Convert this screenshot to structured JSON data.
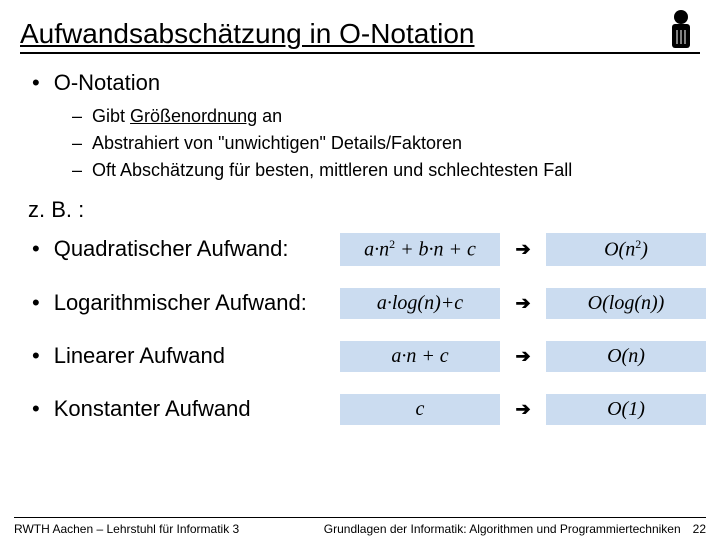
{
  "title": "Aufwandsabschätzung in O-Notation",
  "top_bullet": "O-Notation",
  "sub": {
    "a_pre": "Gibt ",
    "a_u": "Größenordnung",
    "a_post": " an",
    "b": "Abstrahiert von \"unwichtigen\" Details/Faktoren",
    "c": "Oft Abschätzung für besten, mittleren und schlechtesten Fall"
  },
  "zb": "z. B. :",
  "rows": {
    "quad": {
      "label": "Quadratischer Aufwand:",
      "lhs_html": "a·n<sup>2</sup> + b·n + c",
      "rhs_html": "O(n<sup>2</sup>)"
    },
    "log": {
      "label": "Logarithmischer Aufwand:",
      "lhs": "a·log(n)+c",
      "rhs": "O(log(n))"
    },
    "lin": {
      "label": "Linearer Aufwand",
      "lhs": "a·n + c",
      "rhs": "O(n)"
    },
    "const": {
      "label": "Konstanter Aufwand",
      "lhs": "c",
      "rhs": "O(1)"
    }
  },
  "arrow": "➔",
  "footer": {
    "left": "RWTH Aachen – Lehrstuhl für Informatik 3",
    "right": "Grundlagen der Informatik: Algorithmen und Programmiertechniken",
    "page": "22"
  }
}
